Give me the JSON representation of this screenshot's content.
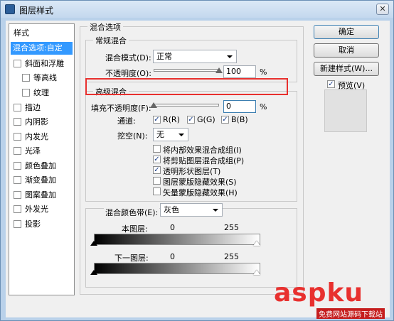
{
  "window": {
    "title": "图层样式",
    "close_glyph": "✕"
  },
  "style_list": {
    "items": [
      {
        "label": "样式",
        "kind": "plain"
      },
      {
        "label": "混合选项:自定",
        "kind": "selected"
      },
      {
        "label": "斜面和浮雕",
        "kind": "check"
      },
      {
        "label": "等高线",
        "kind": "indent"
      },
      {
        "label": "纹理",
        "kind": "indent"
      },
      {
        "label": "描边",
        "kind": "check"
      },
      {
        "label": "内阴影",
        "kind": "check"
      },
      {
        "label": "内发光",
        "kind": "check"
      },
      {
        "label": "光泽",
        "kind": "check"
      },
      {
        "label": "颜色叠加",
        "kind": "check"
      },
      {
        "label": "渐变叠加",
        "kind": "check"
      },
      {
        "label": "图案叠加",
        "kind": "check"
      },
      {
        "label": "外发光",
        "kind": "check"
      },
      {
        "label": "投影",
        "kind": "check"
      }
    ]
  },
  "blend_options": {
    "title": "混合选项",
    "general": {
      "title": "常规混合",
      "mode_label": "混合模式(D):",
      "mode_value": "正常",
      "opacity_label": "不透明度(O):",
      "opacity_value": "100",
      "opacity_unit": "%",
      "opacity_level": 1.0
    },
    "advanced": {
      "title": "高级混合",
      "fill_label": "填充不透明度(F):",
      "fill_value": "0",
      "fill_unit": "%",
      "fill_level": 0.0,
      "channels_label": "通道:",
      "channels": [
        {
          "label": "R(R)",
          "checked": true
        },
        {
          "label": "G(G)",
          "checked": true
        },
        {
          "label": "B(B)",
          "checked": true
        }
      ],
      "knockout_label": "挖空(N):",
      "knockout_value": "无",
      "options": [
        {
          "label": "将内部效果混合成组(I)",
          "checked": false
        },
        {
          "label": "将剪贴图层混合成组(P)",
          "checked": true
        },
        {
          "label": "透明形状图层(T)",
          "checked": true
        },
        {
          "label": "图层蒙版隐藏效果(S)",
          "checked": false
        },
        {
          "label": "矢量蒙版隐藏效果(H)",
          "checked": false
        }
      ]
    },
    "blend_if": {
      "label": "混合颜色带(E):",
      "value": "灰色",
      "this_layer_label": "本图层:",
      "this_layer_low": "0",
      "this_layer_high": "255",
      "under_layer_label": "下一图层:",
      "under_layer_low": "0",
      "under_layer_high": "255"
    }
  },
  "buttons": {
    "ok": "确定",
    "cancel": "取消",
    "new_style": "新建样式(W)...",
    "preview_label": "预览(V)",
    "preview_checked": true
  },
  "check_glyph": "✓",
  "watermark": {
    "text": "aspku",
    "sub": "免费网站源码下载站",
    "color": "#e8302e"
  }
}
